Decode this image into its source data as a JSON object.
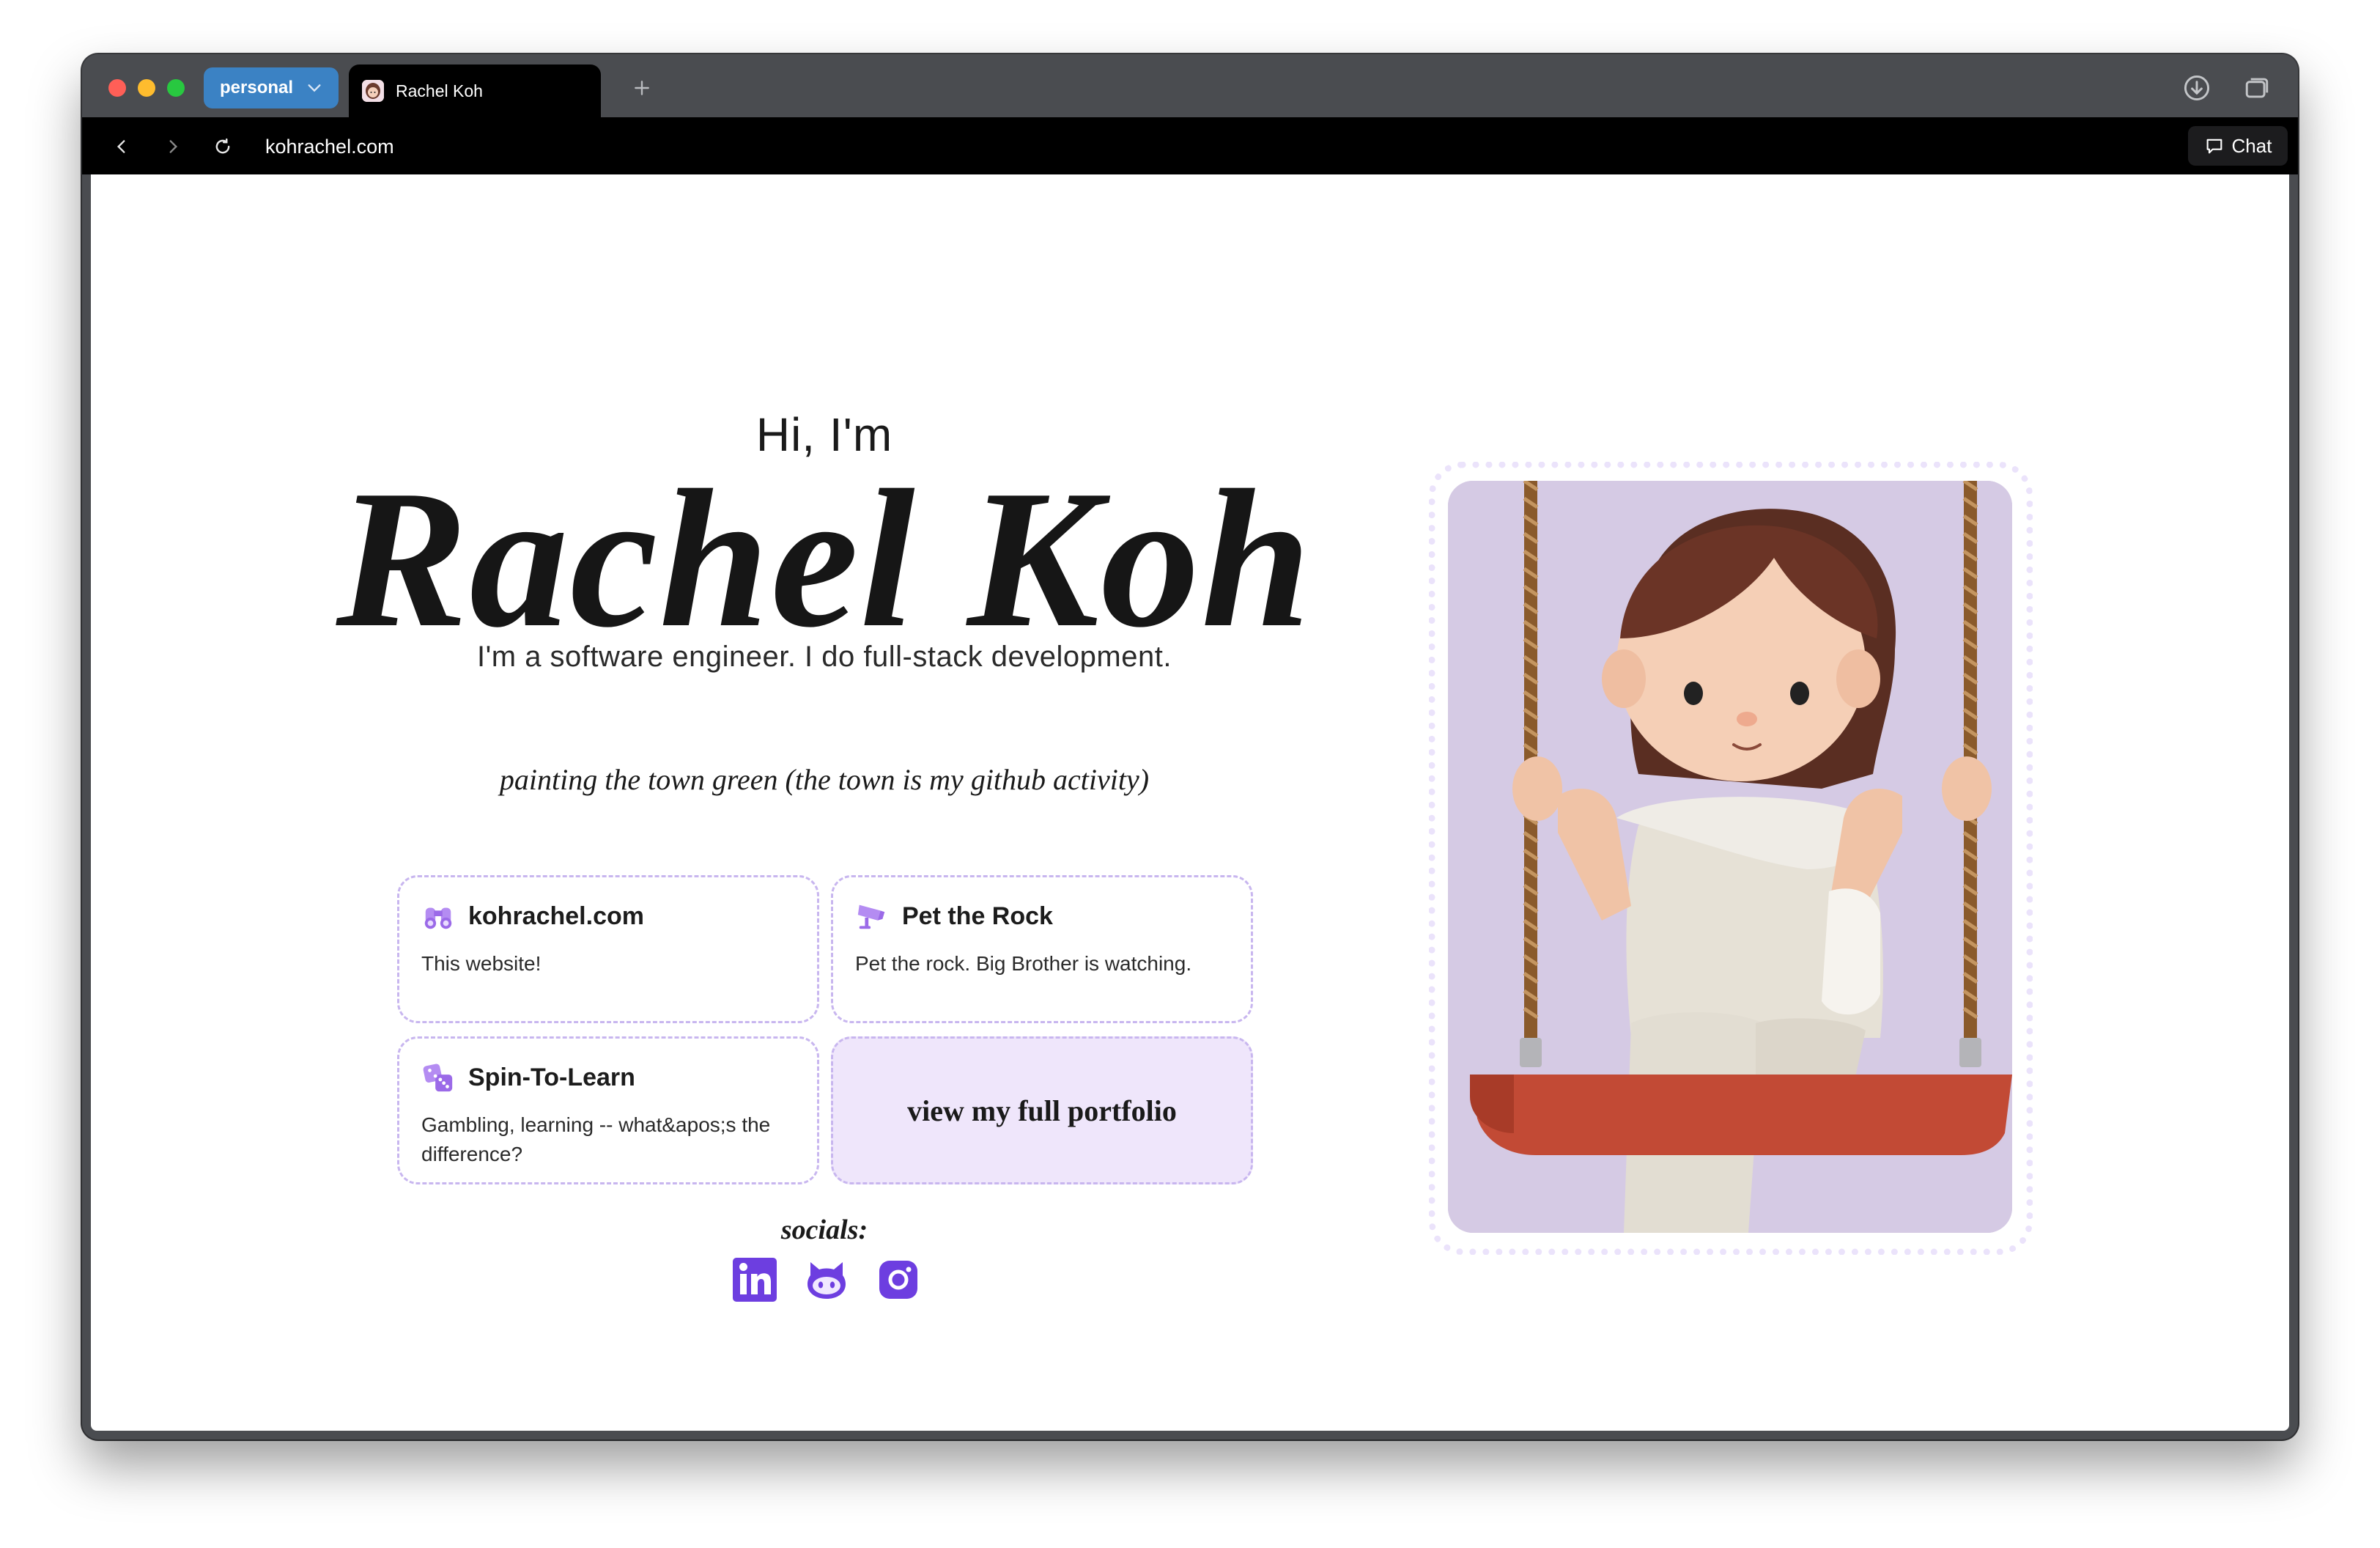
{
  "browser": {
    "profile_label": "personal",
    "tab_title": "Rachel Koh",
    "url": "kohrachel.com",
    "chat_label": "Chat"
  },
  "hero": {
    "greeting": "Hi, I'm",
    "name": "Rachel Koh",
    "tagline": "I'm a software engineer. I do full-stack development.",
    "activity_caption": "painting the town green (the town is my github activity)"
  },
  "projects": [
    {
      "title": "kohrachel.com",
      "description": "This website!",
      "icon": "binoculars-icon"
    },
    {
      "title": "Pet the Rock",
      "description": "Pet the rock. Big Brother is watching.",
      "icon": "security-camera-icon"
    },
    {
      "title": "Spin-To-Learn",
      "description": "Gambling, learning -- what&apos;s the difference?",
      "icon": "dice-icon"
    }
  ],
  "portfolio_link": "view my full portfolio",
  "socials": {
    "label": "socials:",
    "items": [
      "linkedin-icon",
      "github-icon",
      "instagram-icon"
    ]
  },
  "colors": {
    "accent_purple": "#6d3ee0",
    "card_border": "#c8b6ef",
    "portfolio_bg": "#efe6fb",
    "portrait_bg": "#d5cae4",
    "profile_chip": "#3b82c4"
  }
}
